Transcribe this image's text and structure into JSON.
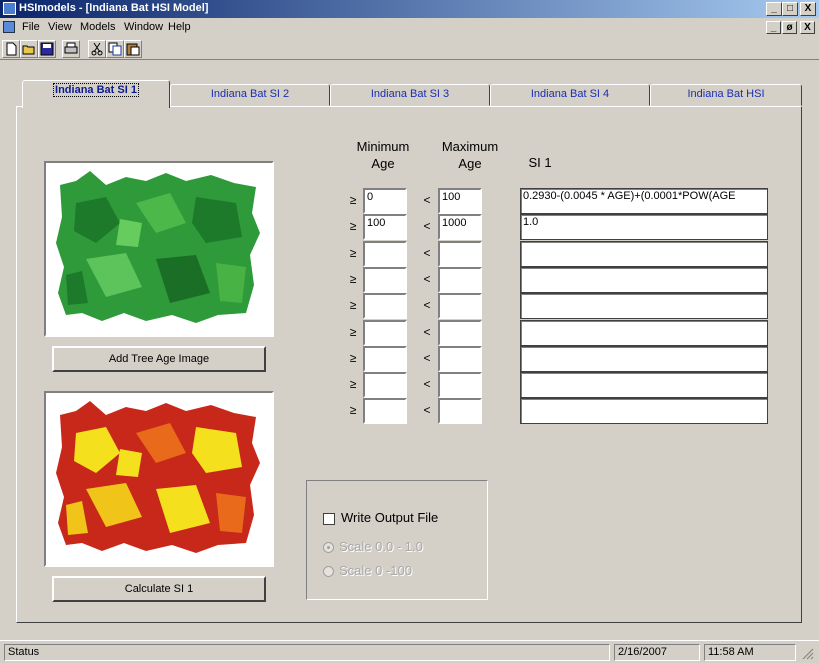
{
  "window": {
    "title": "HSImodels - [Indiana Bat HSI Model]",
    "controls": [
      "_",
      "□",
      "X"
    ],
    "mdi_controls": [
      "_",
      "ø",
      "X"
    ]
  },
  "menu": {
    "items": [
      "File",
      "View",
      "Models",
      "Window",
      "Help"
    ]
  },
  "toolbar": {
    "buttons": [
      "new-icon",
      "open-icon",
      "save-icon",
      "print-icon",
      "cut-icon",
      "copy-icon",
      "paste-icon"
    ]
  },
  "tabs": [
    {
      "label": "Indiana Bat SI 1",
      "active": true
    },
    {
      "label": "Indiana Bat SI 2",
      "active": false
    },
    {
      "label": "Indiana Bat SI 3",
      "active": false
    },
    {
      "label": "Indiana Bat SI 4",
      "active": false
    },
    {
      "label": "Indiana Bat HSI",
      "active": false
    }
  ],
  "left": {
    "add_button": "Add Tree Age Image",
    "calc_button": "Calculate SI 1"
  },
  "grid": {
    "min_header_1": "Minimum",
    "min_header_2": "Age",
    "max_header_1": "Maximum",
    "max_header_2": "Age",
    "si_header": "SI 1",
    "ge_symbol": "≥",
    "lt_symbol": "<",
    "rows": [
      {
        "min": "0",
        "max": "100",
        "si": "0.2930-(0.0045 * AGE)+(0.0001*POW(AGE"
      },
      {
        "min": "100",
        "max": "1000",
        "si": "1.0"
      },
      {
        "min": "",
        "max": "",
        "si": ""
      },
      {
        "min": "",
        "max": "",
        "si": ""
      },
      {
        "min": "",
        "max": "",
        "si": ""
      },
      {
        "min": "",
        "max": "",
        "si": ""
      },
      {
        "min": "",
        "max": "",
        "si": ""
      },
      {
        "min": "",
        "max": "",
        "si": ""
      },
      {
        "min": "",
        "max": "",
        "si": ""
      }
    ]
  },
  "output": {
    "write_label": "Write Output File",
    "write_checked": false,
    "scale1_label": "Scale 0.0 - 1.0",
    "scale1_selected": true,
    "scale2_label": "Scale 0 -100",
    "scale2_selected": false
  },
  "status": {
    "text": "Status",
    "date": "2/16/2007",
    "time": "11:58 AM"
  },
  "colors": {
    "tab_text": "#1a2fb0",
    "forest_green": "#2e9a3a",
    "si_red": "#c8281a",
    "si_yellow": "#f5e01e"
  }
}
